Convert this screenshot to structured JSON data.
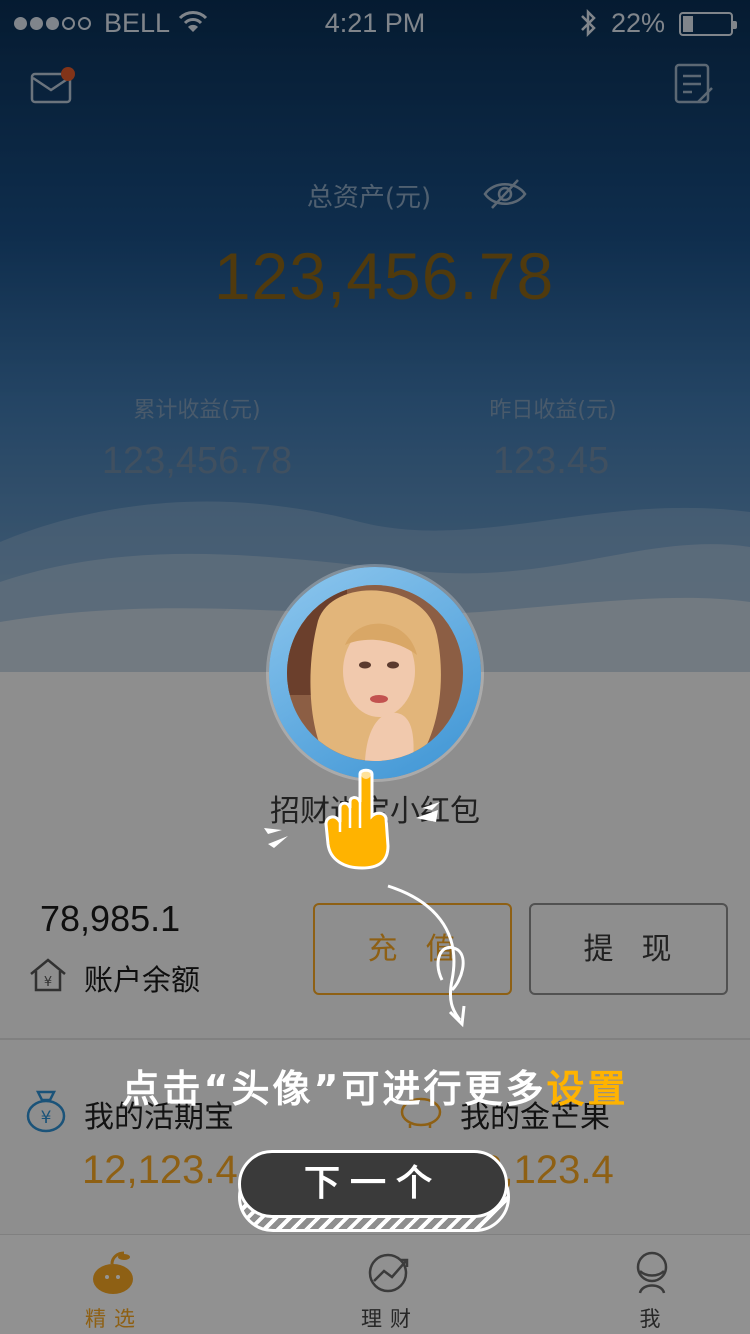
{
  "status_bar": {
    "carrier": "BELL",
    "time": "4:21 PM",
    "battery": "22%"
  },
  "header": {
    "total_label": "总资产(元)",
    "total_value": "123,456.78",
    "cumulative_label": "累计收益(元)",
    "cumulative_value": "123,456.78",
    "yesterday_label": "昨日收益(元)",
    "yesterday_value": "123.45"
  },
  "red_packet_text": "招财进宝小红包",
  "balance": {
    "value": "78,985.1",
    "label": "账户余额"
  },
  "actions": {
    "recharge": "充值",
    "withdraw": "提现"
  },
  "cards": [
    {
      "label": "我的活期宝",
      "value": "12,123.4",
      "icon": "coin-bag-icon"
    },
    {
      "label": "我的金芒果",
      "value": "12,123.4",
      "icon": "piggy-bank-icon"
    }
  ],
  "tabs": [
    {
      "label": "精选",
      "icon": "mango-icon",
      "active": true
    },
    {
      "label": "理财",
      "icon": "trend-icon",
      "active": false
    },
    {
      "label": "我",
      "icon": "profile-icon",
      "active": false
    }
  ],
  "guide": {
    "tip_prefix": "点击“头像”可进行更多",
    "tip_highlight": "设置",
    "next_label": "下一个"
  },
  "colors": {
    "accent": "#f5a623",
    "highlight": "#ffb300",
    "hero_top": "#0a2f55"
  }
}
